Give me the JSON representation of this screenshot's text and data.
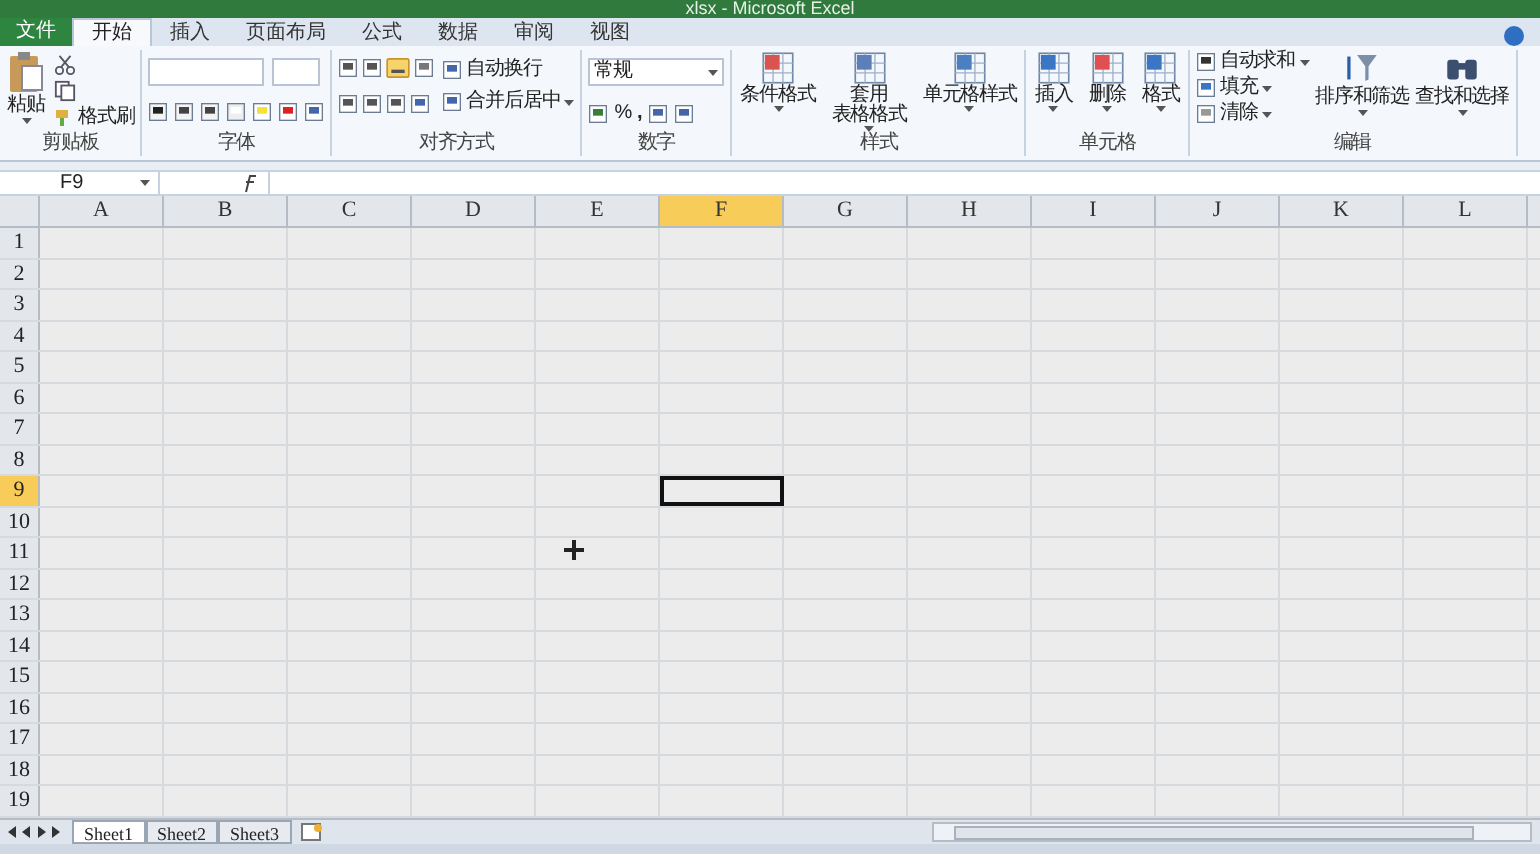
{
  "title": "xlsx - Microsoft Excel",
  "tabs": [
    {
      "label": "文件",
      "kind": "file",
      "selected": false
    },
    {
      "label": "开始",
      "kind": "tab",
      "selected": true
    },
    {
      "label": "插入",
      "kind": "tab",
      "selected": false
    },
    {
      "label": "页面布局",
      "kind": "tab",
      "selected": false
    },
    {
      "label": "公式",
      "kind": "tab",
      "selected": false
    },
    {
      "label": "数据",
      "kind": "tab",
      "selected": false
    },
    {
      "label": "审阅",
      "kind": "tab",
      "selected": false
    },
    {
      "label": "视图",
      "kind": "tab",
      "selected": false
    }
  ],
  "ribbon": [
    {
      "name": "剪贴板",
      "kind": "clipboard",
      "items": [
        {
          "label": "粘贴"
        },
        {
          "label": "格式刷"
        }
      ]
    },
    {
      "name": "字体",
      "kind": "font"
    },
    {
      "name": "对齐方式",
      "kind": "align",
      "items": [
        {
          "label": "自动换行"
        },
        {
          "label": "合并后居中"
        }
      ]
    },
    {
      "name": "数字",
      "kind": "number",
      "items": [
        {
          "label": "常规"
        },
        {
          "label": "%"
        },
        {
          "label": ","
        }
      ]
    },
    {
      "name": "样式",
      "kind": "large",
      "items": [
        {
          "label": "条件格式"
        },
        {
          "label": "套用",
          "label2": "表格格式"
        },
        {
          "label": "单元格样式"
        }
      ]
    },
    {
      "name": "单元格",
      "kind": "large",
      "items": [
        {
          "label": "插入"
        },
        {
          "label": "删除"
        },
        {
          "label": "格式"
        }
      ]
    },
    {
      "name": "编辑",
      "kind": "edit",
      "items": [
        {
          "label": "自动求和"
        },
        {
          "label": "填充"
        },
        {
          "label": "清除"
        },
        {
          "label": "排序和筛选"
        },
        {
          "label": "查找和选择"
        }
      ]
    }
  ],
  "name_box": "F9",
  "columns": [
    {
      "label": "A",
      "selected": false
    },
    {
      "label": "B",
      "selected": false
    },
    {
      "label": "C",
      "selected": false
    },
    {
      "label": "D",
      "selected": false
    },
    {
      "label": "E",
      "selected": false
    },
    {
      "label": "F",
      "selected": true
    },
    {
      "label": "G",
      "selected": false
    },
    {
      "label": "H",
      "selected": false
    },
    {
      "label": "I",
      "selected": false
    },
    {
      "label": "J",
      "selected": false
    },
    {
      "label": "K",
      "selected": false
    },
    {
      "label": "L",
      "selected": false
    }
  ],
  "rows": [
    {
      "label": "1",
      "selected": false
    },
    {
      "label": "2",
      "selected": false
    },
    {
      "label": "3",
      "selected": false
    },
    {
      "label": "4",
      "selected": false
    },
    {
      "label": "5",
      "selected": false
    },
    {
      "label": "6",
      "selected": false
    },
    {
      "label": "7",
      "selected": false
    },
    {
      "label": "8",
      "selected": false
    },
    {
      "label": "9",
      "selected": true
    },
    {
      "label": "10",
      "selected": false
    },
    {
      "label": "11",
      "selected": false
    },
    {
      "label": "12",
      "selected": false
    },
    {
      "label": "13",
      "selected": false
    },
    {
      "label": "14",
      "selected": false
    },
    {
      "label": "15",
      "selected": false
    },
    {
      "label": "16",
      "selected": false
    },
    {
      "label": "17",
      "selected": false
    },
    {
      "label": "18",
      "selected": false
    },
    {
      "label": "19",
      "selected": false
    }
  ],
  "sheets": [
    {
      "label": "Sheet1",
      "selected": true
    },
    {
      "label": "Sheet2",
      "selected": false
    },
    {
      "label": "Sheet3",
      "selected": false
    }
  ]
}
